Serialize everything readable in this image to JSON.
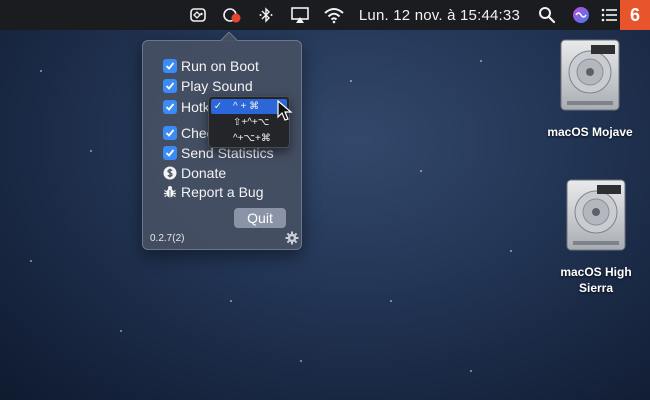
{
  "menubar": {
    "clock": "Lun. 12 nov. à  15:44:33",
    "badge": "6",
    "icons": [
      "app-status-icon",
      "menubar-extra-icon",
      "bluetooth-icon",
      "airplay-icon",
      "wifi-icon",
      "spotlight-search-icon",
      "siri-icon",
      "notification-center-icon"
    ]
  },
  "popover": {
    "items": [
      {
        "label": "Run on Boot",
        "checked": true
      },
      {
        "label": "Play Sound",
        "checked": true
      },
      {
        "label": "Hotk",
        "checked": true
      },
      {
        "label": "Chec",
        "checked": true
      },
      {
        "label": "Send Statistics",
        "checked": true
      },
      {
        "label": "Donate",
        "icon": "dollar-icon"
      },
      {
        "label": "Report a Bug",
        "icon": "bug-icon"
      }
    ],
    "quit_label": "Quit",
    "version": "0.2.7(2)"
  },
  "hotkey_dropdown": {
    "options": [
      {
        "label": "^ + ⌘",
        "selected": true
      },
      {
        "label": "⇧+^+⌥",
        "selected": false
      },
      {
        "label": "^+⌥+⌘",
        "selected": false
      }
    ]
  },
  "desktop": {
    "disks": [
      {
        "label": "macOS Mojave"
      },
      {
        "label": "macOS High Sierra"
      }
    ]
  },
  "colors": {
    "menubar_bg": "#1b1c1f",
    "checkbox_accent": "#3b8bf6",
    "selected_option": "#2b67d8",
    "badge": "#e8542b"
  }
}
